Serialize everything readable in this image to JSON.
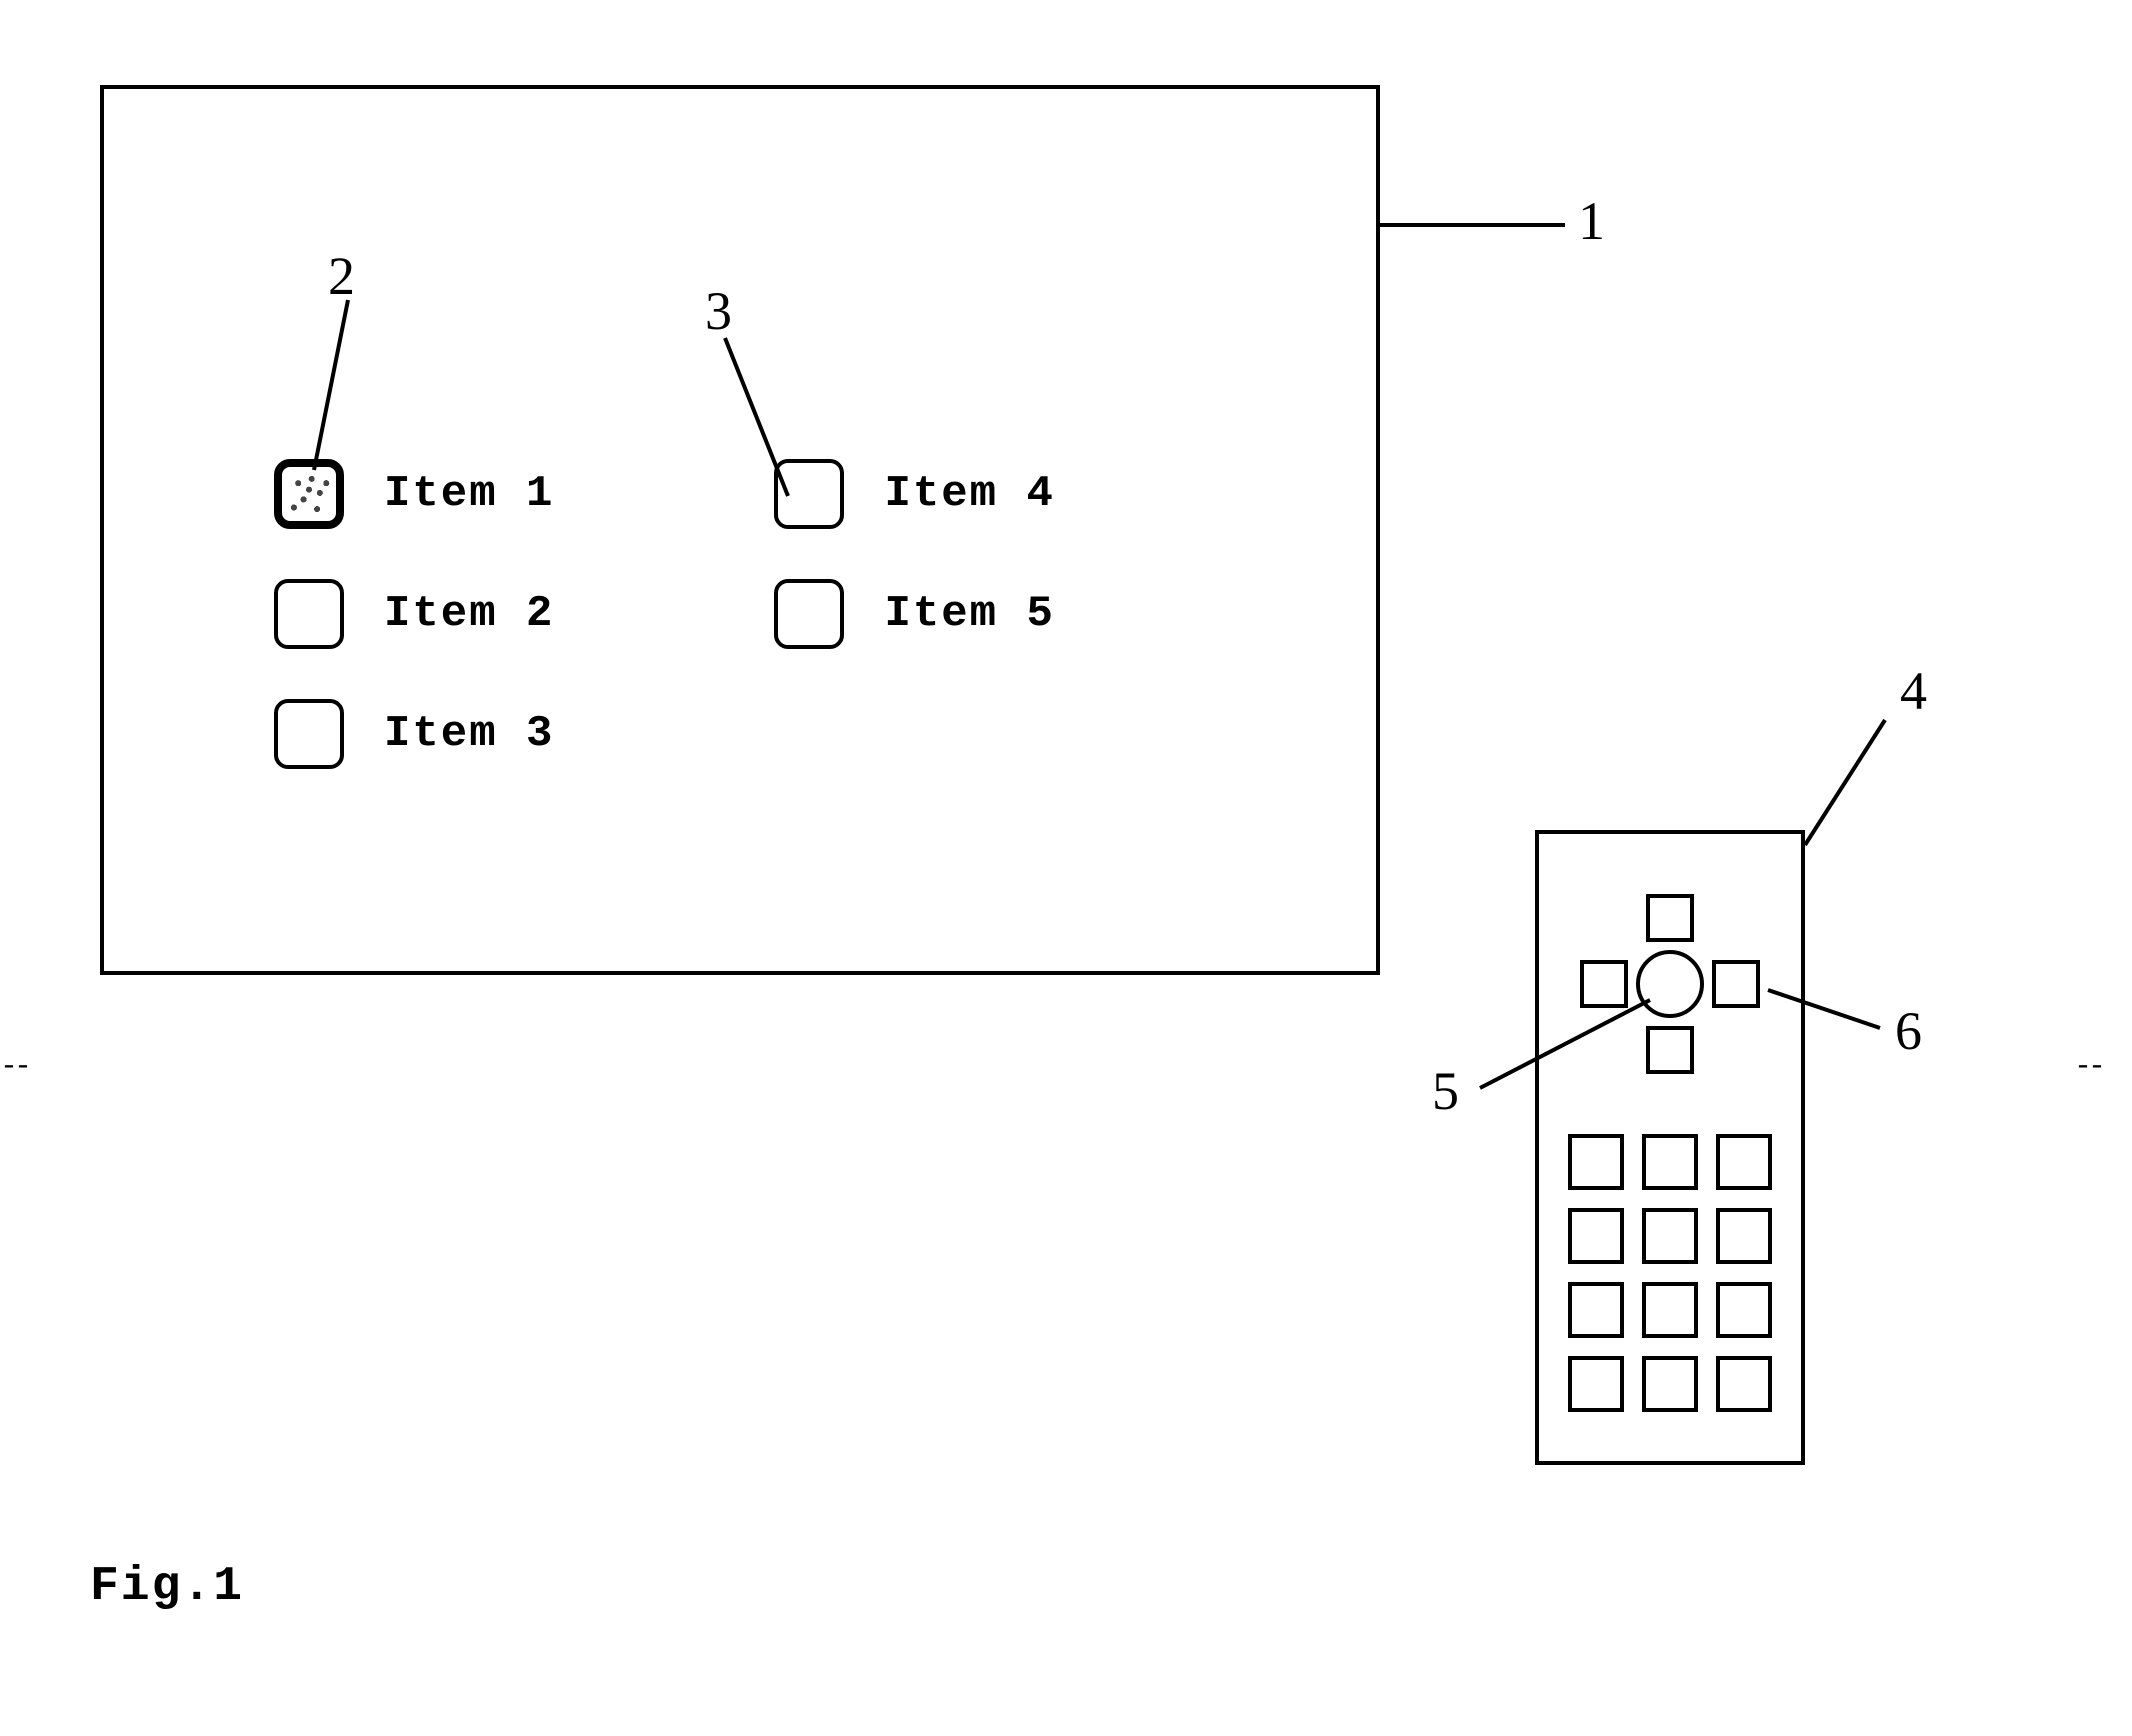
{
  "menu": {
    "col1": [
      {
        "label": "Item 1",
        "selected": true
      },
      {
        "label": "Item 2",
        "selected": false
      },
      {
        "label": "Item 3",
        "selected": false
      }
    ],
    "col2": [
      {
        "label": "Item 4",
        "selected": false
      },
      {
        "label": "Item 5",
        "selected": false
      }
    ]
  },
  "callouts": {
    "screen": "1",
    "selected_item": "2",
    "item_checkbox": "3",
    "remote": "4",
    "ok_button": "5",
    "dpad_right": "6"
  },
  "figure_label": "Fig.1"
}
